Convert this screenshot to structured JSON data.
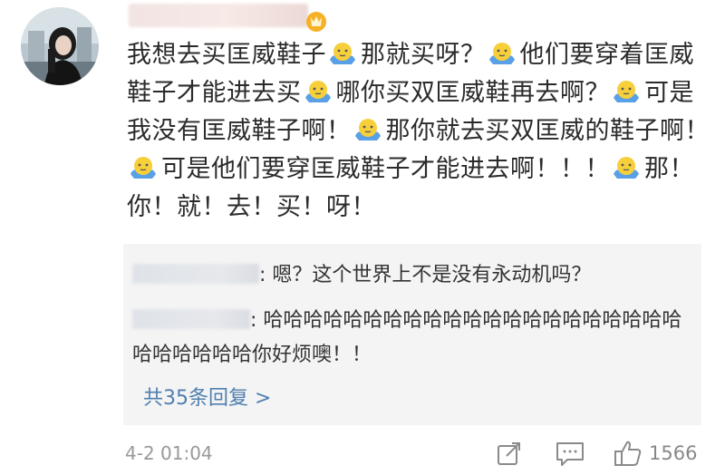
{
  "comment": {
    "parts": [
      {
        "text": "我想去买匡威鞋子"
      },
      {
        "emoji": "shrug-emoji"
      },
      {
        "text": "那就买呀？"
      },
      {
        "emoji": "shrug-emoji"
      },
      {
        "text": "他们要穿着匡威鞋子才能进去买"
      },
      {
        "emoji": "shrug-emoji"
      },
      {
        "text": "哪你买双匡威鞋再去啊？"
      },
      {
        "emoji": "shrug-emoji"
      },
      {
        "text": "可是我没有匡威鞋子啊！"
      },
      {
        "emoji": "shrug-emoji"
      },
      {
        "text": "那你就去买双匡威的鞋子啊！"
      },
      {
        "emoji": "shrug-emoji"
      },
      {
        "text": "可是他们要穿匡威鞋子才能进去啊！！！"
      },
      {
        "emoji": "shrug-emoji"
      },
      {
        "text": "那！你！就！去！买！呀！"
      }
    ]
  },
  "replies": [
    {
      "text": ": 嗯？这个世界上不是没有永动机吗？"
    },
    {
      "text": ": 哈哈哈哈哈哈哈哈哈哈哈哈哈哈哈哈哈哈哈哈哈哈哈哈哈哈哈你好烦噢！！"
    }
  ],
  "more_replies": "共35条回复 >",
  "footer": {
    "time": "4-2 01:04",
    "likes": "1566"
  },
  "icons": {
    "avatar": "avatar-photo",
    "badge": "vip-badge-icon",
    "emoji": "shrug-emoji",
    "share": "share-icon",
    "reply": "comment-icon",
    "like": "thumbs-up-icon"
  },
  "colors": {
    "link": "#4f7fb0",
    "meta": "#999999",
    "reply_bg": "#f4f4f4"
  }
}
